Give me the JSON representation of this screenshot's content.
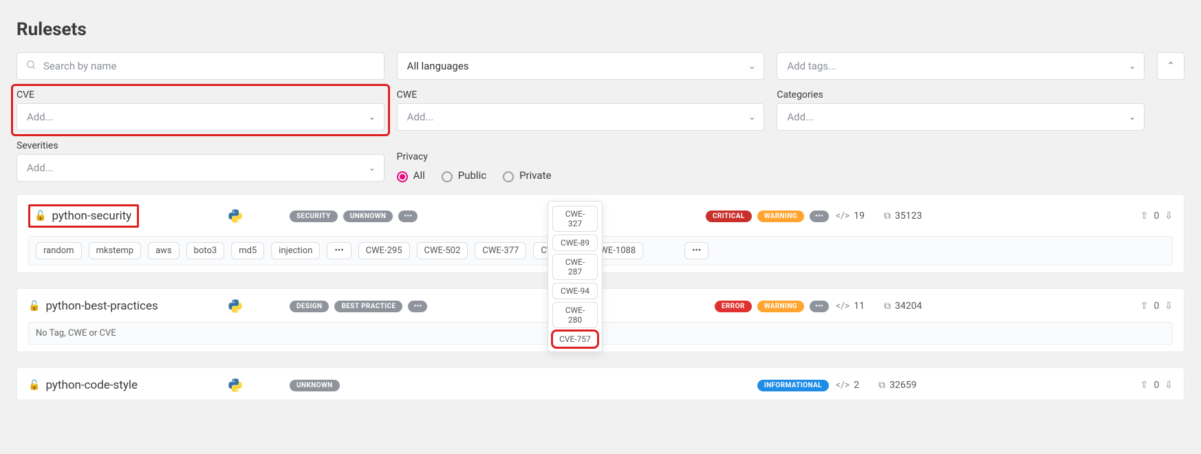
{
  "page": {
    "title": "Rulesets"
  },
  "filters": {
    "search": {
      "placeholder": "Search by name"
    },
    "languages": {
      "text": "All languages"
    },
    "tags": {
      "text": "Add tags..."
    },
    "cve": {
      "label": "CVE",
      "placeholder": "Add..."
    },
    "cwe": {
      "label": "CWE",
      "placeholder": "Add..."
    },
    "categories": {
      "label": "Categories",
      "placeholder": "Add..."
    },
    "severities": {
      "label": "Severities",
      "placeholder": "Add..."
    },
    "privacy": {
      "label": "Privacy",
      "options": {
        "all": "All",
        "public": "Public",
        "private": "Private"
      },
      "selected": "all"
    }
  },
  "popup": {
    "items": [
      "CWE-327",
      "CWE-89",
      "CWE-287",
      "CWE-94",
      "CWE-280",
      "CVE-757"
    ]
  },
  "rulesets": [
    {
      "name": "python-security",
      "lang": "python",
      "type_pills": [
        "SECURITY",
        "UNKNOWN"
      ],
      "sev_pills": [
        {
          "label": "CRITICAL",
          "cls": "darkred"
        },
        {
          "label": "WARNING",
          "cls": "orange"
        }
      ],
      "rules": "19",
      "downloads": "35123",
      "votes": "0",
      "tags": [
        "random",
        "mkstemp",
        "aws",
        "boto3",
        "md5",
        "injection"
      ],
      "cwes": [
        "CWE-295",
        "CWE-502",
        "CWE-377",
        "CWE-78",
        "CWE-1088"
      ]
    },
    {
      "name": "python-best-practices",
      "lang": "python",
      "type_pills": [
        "DESIGN",
        "BEST PRACTICE"
      ],
      "sev_pills": [
        {
          "label": "ERROR",
          "cls": "red"
        },
        {
          "label": "WARNING",
          "cls": "orange"
        }
      ],
      "rules": "11",
      "downloads": "34204",
      "votes": "0",
      "no_tags_text": "No Tag, CWE or CVE"
    },
    {
      "name": "python-code-style",
      "lang": "python",
      "type_pills": [
        "UNKNOWN"
      ],
      "sev_pills": [
        {
          "label": "INFORMATIONAL",
          "cls": "blue"
        }
      ],
      "rules": "2",
      "downloads": "32659",
      "votes": "0"
    }
  ]
}
